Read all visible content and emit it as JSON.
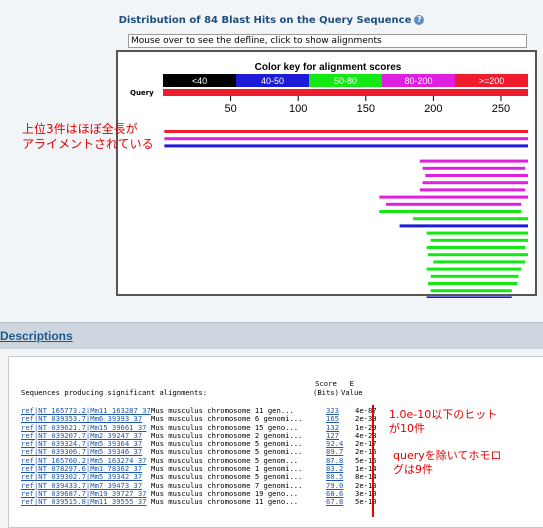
{
  "header": {
    "title": "Distribution of 84 Blast Hits on the Query Sequence",
    "help_icon": "question-help-icon"
  },
  "defline_box": {
    "text": "Mouse over to see the defline, click to show alignments"
  },
  "color_key": {
    "title": "Color key for alignment scores",
    "bins": [
      {
        "label": "<40",
        "color": "#000000"
      },
      {
        "label": "40-50",
        "color": "#1c1cd8"
      },
      {
        "label": "50-80",
        "color": "#14e814"
      },
      {
        "label": "80-200",
        "color": "#e020e0"
      },
      {
        "label": ">=200",
        "color": "#ee1c2c"
      }
    ],
    "query_label": "Query",
    "query_color": "#ee1c2c",
    "axis_ticks": [
      "50",
      "100",
      "150",
      "200",
      "250"
    ]
  },
  "annotations": {
    "top_line1": "上位3件はほぼ全長が",
    "top_line2": "アライメントされている",
    "hits_line1": "1.0e-10以下のヒット",
    "hits_line2": "が10件",
    "homolog_line1": "queryを除いてホモロ",
    "homolog_line2": "グは9件"
  },
  "section": {
    "title": "Descriptions"
  },
  "results": {
    "header": "Sequences producing significant alignments:",
    "score_col_line1": "Score",
    "score_col_line2": "(Bits)",
    "e_col_line1": "E",
    "e_col_line2": "Value",
    "rows": [
      {
        "acc": "ref|NT_165773.2|Mm11_163287_37",
        "desc": "Mus musculus chromosome 11 gen...",
        "score": "323",
        "evalue": "4e-87"
      },
      {
        "acc": "ref|NT_039353.7|Mm6_39393_37",
        "desc": "Mus musculus chromosome 6 genomi...",
        "score": "165",
        "evalue": "2e-39"
      },
      {
        "acc": "ref|NT_039621.7|Mm15_39661_37",
        "desc": "Mus musculus chromosome 15 geno...",
        "score": "132",
        "evalue": "1e-29"
      },
      {
        "acc": "ref|NT_039207.7|Mm2_39247_37",
        "desc": "Mus musculus chromosome 2 genomi...",
        "score": "127",
        "evalue": "4e-28"
      },
      {
        "acc": "ref|NT_039324.7|Mm5_39364_37",
        "desc": "Mus musculus chromosome 5 genomi...",
        "score": "92.4",
        "evalue": "2e-17"
      },
      {
        "acc": "ref|NT_039306.7|Mm5_39346_37",
        "desc": "Mus musculus chromosome 5 genomi...",
        "score": "89.7",
        "evalue": "2e-16"
      },
      {
        "acc": "ref|NT_165760.2|Mm5_163274_37",
        "desc": "Mus musculus chromosome 5 genom...",
        "score": "87.8",
        "evalue": "5e-16"
      },
      {
        "acc": "ref|NT_078297.6|Mm1_78362_37",
        "desc": "Mus musculus chromosome 1 genomi...",
        "score": "83.2",
        "evalue": "1e-14"
      },
      {
        "acc": "ref|NT_039302.7|Mm5_39342_37",
        "desc": "Mus musculus chromosome 5 genomi...",
        "score": "80.5",
        "evalue": "8e-14"
      },
      {
        "acc": "ref|NT_039433.7|Mm7_39473_37",
        "desc": "Mus musculus chromosome 7 genomi...",
        "score": "79.0",
        "evalue": "2e-13"
      },
      {
        "acc": "ref|NT_039687.7|Mm19_39727_37",
        "desc": "Mus musculus chromosome 19 geno...",
        "score": "68.6",
        "evalue": "3e-10"
      },
      {
        "acc": "ref|NT_039515.8|Mm11_39555_37",
        "desc": "Mus musculus chromosome 11 geno...",
        "score": "67.8",
        "evalue": "5e-10"
      }
    ]
  },
  "hit_bars": [
    {
      "start": 1,
      "end": 270,
      "color": "#ee1c2c"
    },
    {
      "start": 1,
      "end": 270,
      "color": "#e020e0"
    },
    {
      "start": 1,
      "end": 270,
      "color": "#1c1cd8"
    },
    {
      "start": 190,
      "end": 270,
      "color": "#e020e0"
    },
    {
      "start": 192,
      "end": 268,
      "color": "#e020e0"
    },
    {
      "start": 194,
      "end": 270,
      "color": "#e020e0"
    },
    {
      "start": 192,
      "end": 270,
      "color": "#e020e0"
    },
    {
      "start": 190,
      "end": 268,
      "color": "#e020e0"
    },
    {
      "start": 160,
      "end": 270,
      "color": "#e020e0"
    },
    {
      "start": 165,
      "end": 265,
      "color": "#e020e0"
    },
    {
      "start": 160,
      "end": 265,
      "color": "#14e814"
    },
    {
      "start": 185,
      "end": 270,
      "color": "#14e814"
    },
    {
      "start": 175,
      "end": 270,
      "color": "#1c1cd8"
    },
    {
      "start": 195,
      "end": 270,
      "color": "#14e814"
    },
    {
      "start": 198,
      "end": 270,
      "color": "#14e814"
    },
    {
      "start": 195,
      "end": 268,
      "color": "#14e814"
    },
    {
      "start": 196,
      "end": 270,
      "color": "#14e814"
    },
    {
      "start": 200,
      "end": 268,
      "color": "#14e814"
    },
    {
      "start": 195,
      "end": 265,
      "color": "#14e814"
    },
    {
      "start": 198,
      "end": 263,
      "color": "#14e814"
    },
    {
      "start": 196,
      "end": 262,
      "color": "#14e814"
    },
    {
      "start": 198,
      "end": 258,
      "color": "#14e814"
    },
    {
      "start": 195,
      "end": 258,
      "color": "#1c1cd8"
    }
  ]
}
